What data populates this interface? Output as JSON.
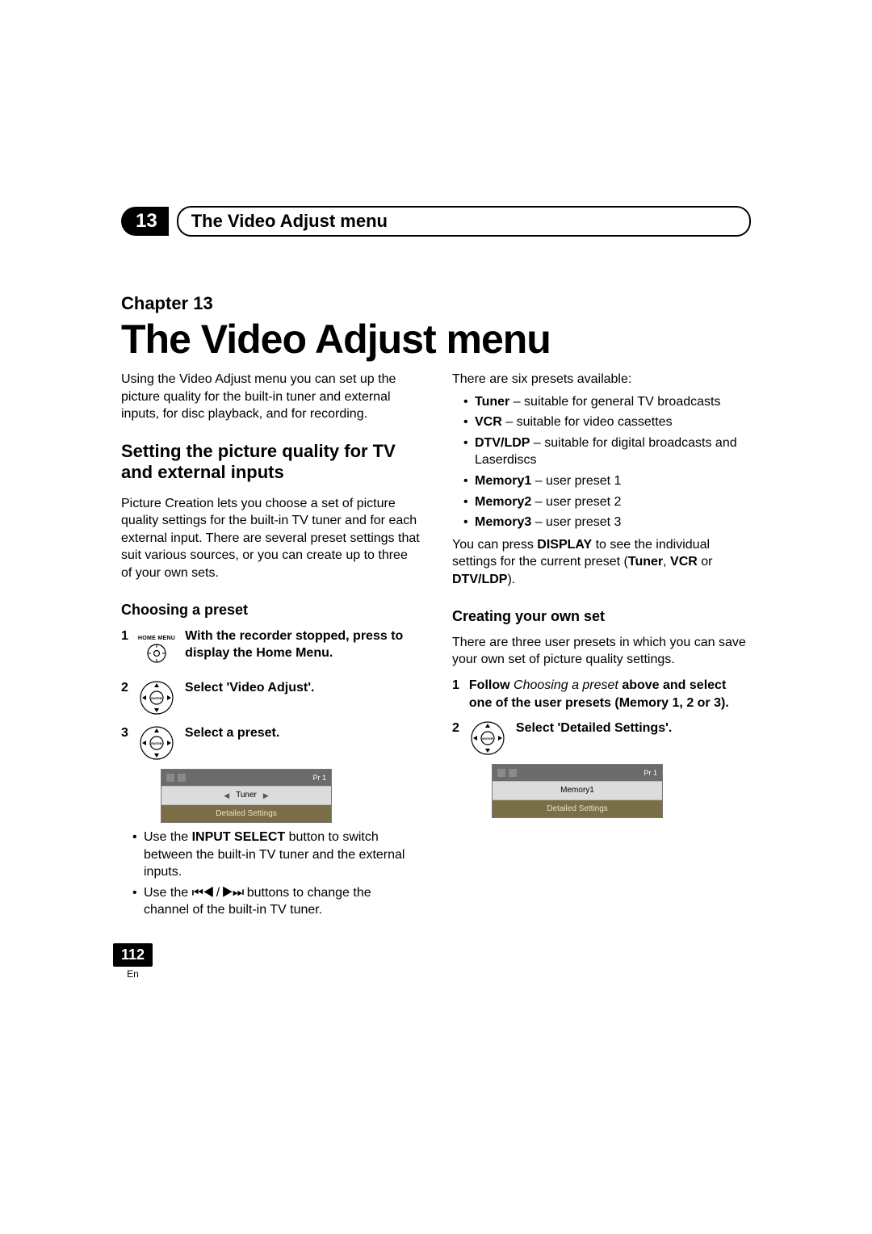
{
  "running_head": {
    "chapter_number": "13",
    "title": "The Video Adjust menu"
  },
  "chapter": {
    "label": "Chapter 13",
    "title": "The Video Adjust menu",
    "intro": "Using the Video Adjust menu you can set up the picture quality for the built-in tuner and external inputs, for disc playback, and for recording."
  },
  "section1": {
    "heading": "Setting the picture quality for TV and external inputs",
    "intro": "Picture Creation lets you choose a set of picture quality settings for the built-in TV tuner and for each external input. There are several preset settings that suit various sources, or you can create up to three of your own sets."
  },
  "choosing": {
    "heading": "Choosing a preset",
    "home_menu_label": "HOME MENU",
    "step1": "With the recorder stopped, press to display the Home Menu.",
    "step2": "Select 'Video Adjust'.",
    "step3": "Select a preset.",
    "osd": {
      "pr": "Pr 1",
      "row1": "Tuner",
      "row2": "Detailed Settings"
    },
    "notes": {
      "n1_a": "Use the ",
      "n1_b": "INPUT SELECT",
      "n1_c": " button to switch between the built-in TV tuner and the external inputs.",
      "n2_a": "Use the ",
      "n2_b": "⏮◀ / ▶⏭",
      "n2_c": " buttons to change the channel of the built-in TV tuner."
    }
  },
  "presets": {
    "lead": "There are six presets available:",
    "items": [
      {
        "name": "Tuner",
        "desc": " – suitable for general TV broadcasts"
      },
      {
        "name": "VCR",
        "desc": " – suitable for video cassettes"
      },
      {
        "name": "DTV/LDP",
        "desc": " – suitable for digital broadcasts and Laserdiscs"
      },
      {
        "name": "Memory1",
        "desc": " – user preset 1"
      },
      {
        "name": "Memory2",
        "desc": " – user preset 2"
      },
      {
        "name": "Memory3",
        "desc": " – user preset 3"
      }
    ],
    "tail_a": "You can press ",
    "tail_b": "DISPLAY",
    "tail_c": " to see the individual settings for the current preset (",
    "tail_d": "Tuner",
    "tail_e": ", ",
    "tail_f": "VCR",
    "tail_g": " or ",
    "tail_h": "DTV/LDP",
    "tail_i": ")."
  },
  "creating": {
    "heading": "Creating your own set",
    "intro": "There are three user presets in which you can save your own set of picture quality settings.",
    "step1_a": "Follow ",
    "step1_b": "Choosing a preset",
    "step1_c": " above and select one of the user presets (Memory 1, 2 or 3).",
    "step2": "Select 'Detailed Settings'.",
    "osd": {
      "pr": "Pr 1",
      "row1": "Memory1",
      "row2": "Detailed Settings"
    }
  },
  "footer": {
    "page": "112",
    "lang": "En"
  },
  "icons": {
    "enter": "ENTER"
  }
}
